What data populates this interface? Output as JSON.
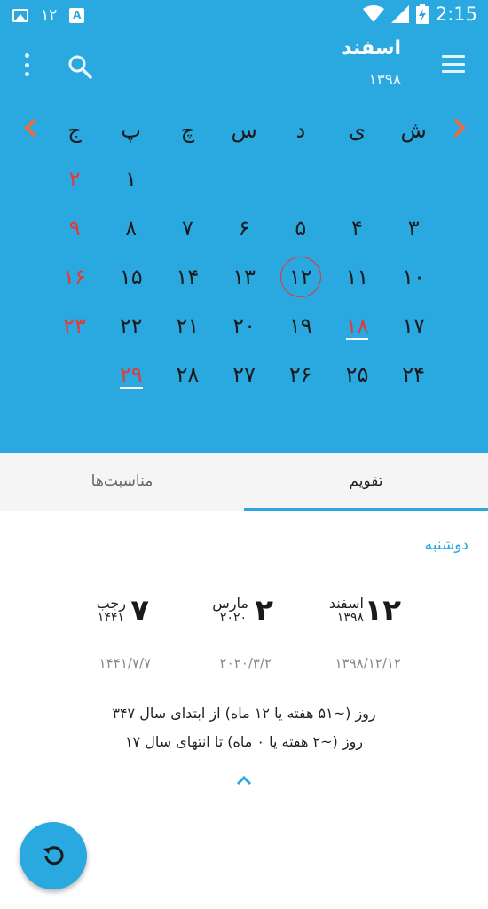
{
  "status_bar": {
    "notif_number": "۱۲",
    "time": "2:15"
  },
  "header": {
    "month": "اسفند",
    "year": "۱۳۹۸"
  },
  "weekdays": [
    "ش",
    "ی",
    "د",
    "س",
    "چ",
    "پ",
    "ج"
  ],
  "weeks": [
    [
      "",
      "",
      "",
      "",
      "",
      "۱",
      "۲"
    ],
    [
      "۳",
      "۴",
      "۵",
      "۶",
      "۷",
      "۸",
      "۹"
    ],
    [
      "۱۰",
      "۱۱",
      "۱۲",
      "۱۳",
      "۱۴",
      "۱۵",
      "۱۶"
    ],
    [
      "۱۷",
      "۱۸",
      "۱۹",
      "۲۰",
      "۲۱",
      "۲۲",
      "۲۳"
    ],
    [
      "۲۴",
      "۲۵",
      "۲۶",
      "۲۷",
      "۲۸",
      "۲۹",
      ""
    ]
  ],
  "tabs": {
    "calendar": "تقویم",
    "events": "مناسبت‌ها"
  },
  "selected": {
    "weekday": "دوشنبه",
    "persian": {
      "day": "۱۲",
      "month": "اسفند",
      "year": "۱۳۹۸",
      "numeric": "۱۳۹۸/۱۲/۱۲"
    },
    "gregorian": {
      "day": "۲",
      "month": "مارس",
      "year": "۲۰۲۰",
      "numeric": "۲۰۲۰/۳/۲"
    },
    "islamic": {
      "day": "۷",
      "month": "رجب",
      "year": "۱۴۴۱",
      "numeric": "۱۴۴۱/۷/۷"
    }
  },
  "info": {
    "line1": "۳۴۷ روز (~۵۱ هفته یا ۱۲ ماه) از ابتدای سال",
    "line2": "۱۷ روز (~۲ هفته یا ۰ ماه) تا انتهای سال"
  },
  "colors": {
    "primary": "#2aa8e0",
    "holiday": "#e53935",
    "nav_arrow": "#f06a3a"
  }
}
